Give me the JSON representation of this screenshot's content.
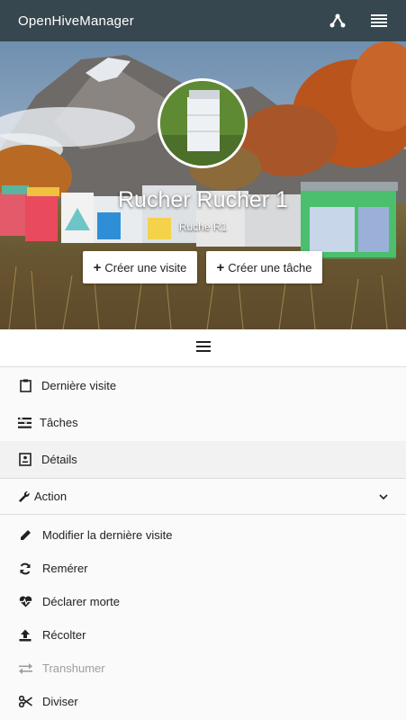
{
  "topbar": {
    "title": "OpenHiveManager",
    "icons": [
      "share-nodes-icon",
      "list-menu-icon"
    ]
  },
  "hero": {
    "title": "Rucher Rucher 1",
    "subtitle": "Ruche R1",
    "buttons": {
      "create_visit": "Créer une visite",
      "create_task": "Créer une tâche"
    }
  },
  "menu": {
    "items": [
      {
        "label": "Dernière visite",
        "icon": "clipboard-icon"
      },
      {
        "label": "Tâches",
        "icon": "tasks-icon"
      },
      {
        "label": "Détails",
        "icon": "details-icon",
        "active": true
      }
    ],
    "action": {
      "label": "Action",
      "icon": "wrench-icon",
      "items": [
        {
          "label": "Modifier la dernière visite",
          "icon": "pencil-icon"
        },
        {
          "label": "Remérer",
          "icon": "refresh-icon"
        },
        {
          "label": "Déclarer morte",
          "icon": "heartbeat-icon"
        },
        {
          "label": "Récolter",
          "icon": "upload-icon"
        },
        {
          "label": "Transhumer",
          "icon": "exchange-icon",
          "disabled": true
        },
        {
          "label": "Diviser",
          "icon": "scissors-icon"
        }
      ]
    }
  },
  "colors": {
    "topbar": "#37474f",
    "disabled_text": "#9e9e9e"
  }
}
